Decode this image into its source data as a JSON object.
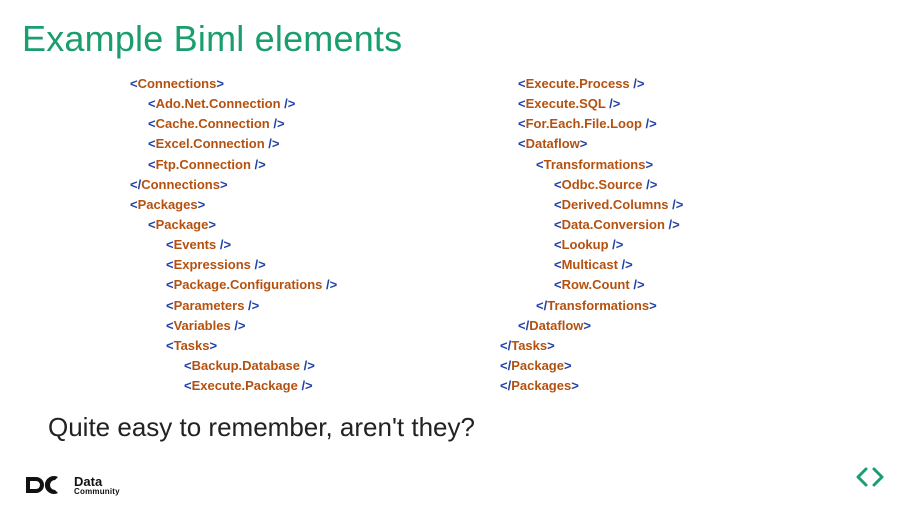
{
  "title": "Example Biml elements",
  "subtitle": "Quite easy to remember, aren't they?",
  "footer": {
    "brand_main": "Data",
    "brand_sub": "Community"
  },
  "code_left": [
    {
      "indent": 0,
      "open": "<",
      "name": "Connections",
      "close": ">"
    },
    {
      "indent": 1,
      "open": "<",
      "name": "Ado.Net.Connection",
      "close": " />"
    },
    {
      "indent": 1,
      "open": "<",
      "name": "Cache.Connection",
      "close": " />"
    },
    {
      "indent": 1,
      "open": "<",
      "name": "Excel.Connection",
      "close": " />"
    },
    {
      "indent": 1,
      "open": "<",
      "name": "Ftp.Connection",
      "close": " />"
    },
    {
      "indent": 0,
      "open": "</",
      "name": "Connections",
      "close": ">"
    },
    {
      "indent": 0,
      "open": "<",
      "name": "Packages",
      "close": ">"
    },
    {
      "indent": 1,
      "open": "<",
      "name": "Package",
      "close": ">"
    },
    {
      "indent": 2,
      "open": "<",
      "name": "Events",
      "close": " />"
    },
    {
      "indent": 2,
      "open": "<",
      "name": "Expressions",
      "close": " />"
    },
    {
      "indent": 2,
      "open": "<",
      "name": "Package.Configurations",
      "close": " />"
    },
    {
      "indent": 2,
      "open": "<",
      "name": "Parameters",
      "close": " />"
    },
    {
      "indent": 2,
      "open": "<",
      "name": "Variables",
      "close": " />"
    },
    {
      "indent": 2,
      "open": "<",
      "name": "Tasks",
      "close": ">"
    },
    {
      "indent": 3,
      "open": "<",
      "name": "Backup.Database",
      "close": " />"
    },
    {
      "indent": 3,
      "open": "<",
      "name": "Execute.Package",
      "close": " />"
    }
  ],
  "code_right": [
    {
      "indent": 3,
      "open": "<",
      "name": "Execute.Process",
      "close": " />"
    },
    {
      "indent": 3,
      "open": "<",
      "name": "Execute.SQL",
      "close": " />"
    },
    {
      "indent": 3,
      "open": "<",
      "name": "For.Each.File.Loop",
      "close": " />"
    },
    {
      "indent": 3,
      "open": "<",
      "name": "Dataflow",
      "close": ">"
    },
    {
      "indent": 4,
      "open": "<",
      "name": "Transformations",
      "close": ">"
    },
    {
      "indent": 5,
      "open": "<",
      "name": "Odbc.Source",
      "close": " />"
    },
    {
      "indent": 5,
      "open": "<",
      "name": "Derived.Columns",
      "close": " />"
    },
    {
      "indent": 5,
      "open": "<",
      "name": "Data.Conversion",
      "close": " />"
    },
    {
      "indent": 5,
      "open": "<",
      "name": "Lookup",
      "close": " />"
    },
    {
      "indent": 5,
      "open": "<",
      "name": "Multicast",
      "close": " />"
    },
    {
      "indent": 5,
      "open": "<",
      "name": "Row.Count",
      "close": " />"
    },
    {
      "indent": 4,
      "open": "</",
      "name": "Transformations",
      "close": ">"
    },
    {
      "indent": 3,
      "open": "</",
      "name": "Dataflow",
      "close": ">"
    },
    {
      "indent": 2,
      "open": "</",
      "name": "Tasks",
      "close": ">"
    },
    {
      "indent": 1,
      "open": "</",
      "name": "Package",
      "close": ">"
    },
    {
      "indent": 0,
      "open": "</",
      "name": "Packages",
      "close": ">"
    }
  ]
}
